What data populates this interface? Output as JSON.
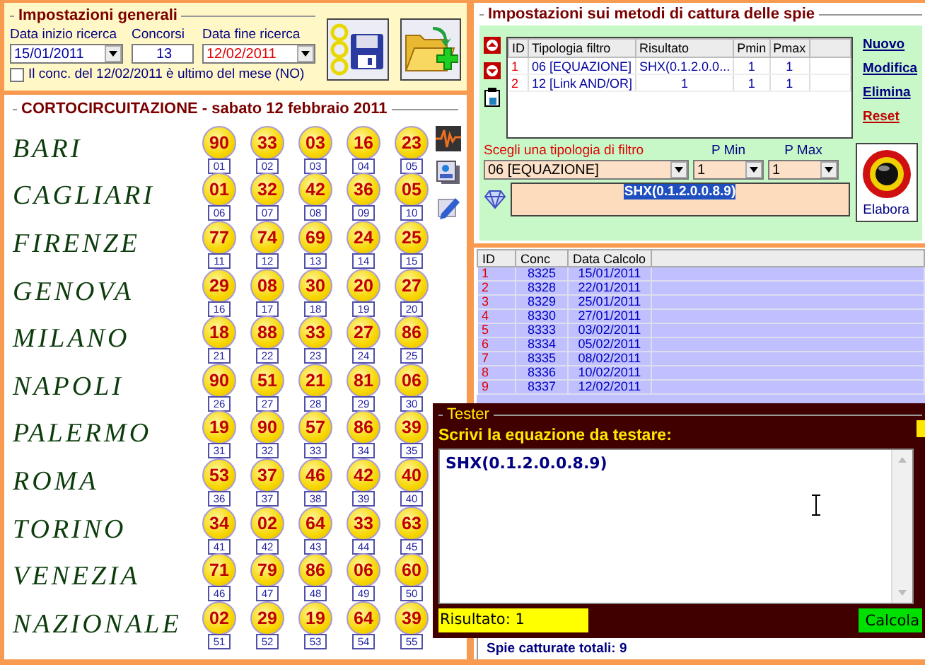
{
  "general_settings": {
    "title": "Impostazioni generali",
    "start_date": {
      "label": "Data inizio ricerca",
      "value": "15/01/2011"
    },
    "draws": {
      "label": "Concorsi",
      "value": "13"
    },
    "end_date": {
      "label": "Data fine ricerca",
      "value": "12/02/2011"
    },
    "last_of_month": {
      "label": "Il conc. del 12/02/2011 è ultimo del mese (NO)",
      "checked": false
    }
  },
  "draw_panel": {
    "title": "CORTOCIRCUITAZIONE - sabato 12 febbraio 2011",
    "wheels": [
      {
        "name": "BARI",
        "numbers": [
          [
            "90",
            "01"
          ],
          [
            "33",
            "02"
          ],
          [
            "03",
            "03"
          ],
          [
            "16",
            "04"
          ],
          [
            "23",
            "05"
          ]
        ]
      },
      {
        "name": "CAGLIARI",
        "numbers": [
          [
            "01",
            "06"
          ],
          [
            "32",
            "07"
          ],
          [
            "42",
            "08"
          ],
          [
            "36",
            "09"
          ],
          [
            "05",
            "10"
          ]
        ]
      },
      {
        "name": "FIRENZE",
        "numbers": [
          [
            "77",
            "11"
          ],
          [
            "74",
            "12"
          ],
          [
            "69",
            "13"
          ],
          [
            "24",
            "14"
          ],
          [
            "25",
            "15"
          ]
        ]
      },
      {
        "name": "GENOVA",
        "numbers": [
          [
            "29",
            "16"
          ],
          [
            "08",
            "17"
          ],
          [
            "30",
            "18"
          ],
          [
            "20",
            "19"
          ],
          [
            "27",
            "20"
          ]
        ]
      },
      {
        "name": "MILANO",
        "numbers": [
          [
            "18",
            "21"
          ],
          [
            "88",
            "22"
          ],
          [
            "33",
            "23"
          ],
          [
            "27",
            "24"
          ],
          [
            "86",
            "25"
          ]
        ]
      },
      {
        "name": "NAPOLI",
        "numbers": [
          [
            "90",
            "26"
          ],
          [
            "51",
            "27"
          ],
          [
            "21",
            "28"
          ],
          [
            "81",
            "29"
          ],
          [
            "06",
            "30"
          ]
        ]
      },
      {
        "name": "PALERMO",
        "numbers": [
          [
            "19",
            "31"
          ],
          [
            "90",
            "32"
          ],
          [
            "57",
            "33"
          ],
          [
            "86",
            "34"
          ],
          [
            "39",
            "35"
          ]
        ]
      },
      {
        "name": "ROMA",
        "numbers": [
          [
            "53",
            "36"
          ],
          [
            "37",
            "37"
          ],
          [
            "46",
            "38"
          ],
          [
            "42",
            "39"
          ],
          [
            "40",
            "40"
          ]
        ]
      },
      {
        "name": "TORINO",
        "numbers": [
          [
            "34",
            "41"
          ],
          [
            "02",
            "42"
          ],
          [
            "64",
            "43"
          ],
          [
            "33",
            "44"
          ],
          [
            "63",
            "45"
          ]
        ]
      },
      {
        "name": "VENEZIA",
        "numbers": [
          [
            "71",
            "46"
          ],
          [
            "79",
            "47"
          ],
          [
            "86",
            "48"
          ],
          [
            "06",
            "49"
          ],
          [
            "60",
            "50"
          ]
        ]
      },
      {
        "name": "NAZIONALE",
        "numbers": [
          [
            "02",
            "51"
          ],
          [
            "29",
            "52"
          ],
          [
            "19",
            "53"
          ],
          [
            "64",
            "54"
          ],
          [
            "39",
            "55"
          ]
        ]
      }
    ]
  },
  "capture_settings": {
    "title": "Impostazioni sui metodi di cattura delle spie",
    "filters": {
      "columns": [
        "ID",
        "Tipologia filtro",
        "Risultato",
        "Pmin",
        "Pmax"
      ],
      "rows": [
        {
          "id": "1",
          "type": "06 [EQUAZIONE]",
          "result": "SHX(0.1.2.0.0...",
          "pmin": "1",
          "pmax": "1"
        },
        {
          "id": "2",
          "type": "12 [Link AND/OR]",
          "result": "1",
          "pmin": "1",
          "pmax": "1"
        }
      ]
    },
    "links": [
      {
        "label": "Nuovo",
        "kind": "normal"
      },
      {
        "label": "Modifica",
        "kind": "normal"
      },
      {
        "label": "Elimina",
        "kind": "normal"
      },
      {
        "label": "Reset",
        "kind": "danger"
      }
    ],
    "filter_select": {
      "label": "Scegli una tipologia di filtro",
      "value": "06 [EQUAZIONE]"
    },
    "pmin": {
      "label": "P Min",
      "value": "1"
    },
    "pmax": {
      "label": "P Max",
      "value": "1"
    },
    "equation": {
      "value": "SHX(0.1.2.0.0.8.9)",
      "selected": true
    },
    "run_button": "Elabora"
  },
  "results": {
    "columns": [
      "ID",
      "Conc",
      "Data Calcolo"
    ],
    "rows": [
      {
        "id": "1",
        "conc": "8325",
        "date": "15/01/2011"
      },
      {
        "id": "2",
        "conc": "8328",
        "date": "22/01/2011"
      },
      {
        "id": "3",
        "conc": "8329",
        "date": "25/01/2011"
      },
      {
        "id": "4",
        "conc": "8330",
        "date": "27/01/2011"
      },
      {
        "id": "5",
        "conc": "8333",
        "date": "03/02/2011"
      },
      {
        "id": "6",
        "conc": "8334",
        "date": "05/02/2011"
      },
      {
        "id": "7",
        "conc": "8335",
        "date": "08/02/2011"
      },
      {
        "id": "8",
        "conc": "8336",
        "date": "10/02/2011"
      },
      {
        "id": "9",
        "conc": "8337",
        "date": "12/02/2011"
      }
    ],
    "total": "Spie catturate totali: 9"
  },
  "tester": {
    "title": "Tester",
    "prompt": "Scrivi la equazione da testare:",
    "equation": "SHX(0.1.2.0.0.8.9)",
    "result": "Risultato: 1",
    "button": "Calcola"
  }
}
